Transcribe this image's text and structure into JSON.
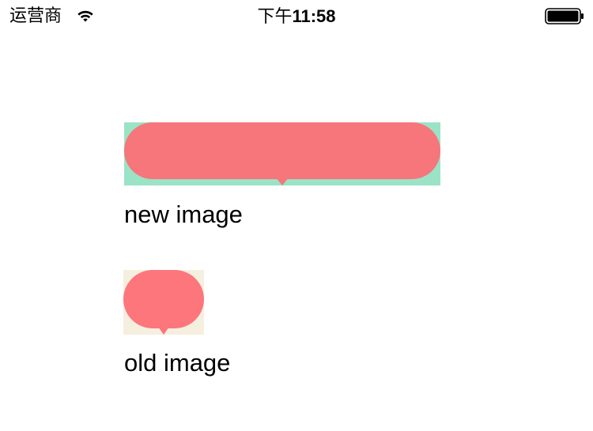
{
  "status_bar": {
    "carrier": "运营商",
    "time_prefix": "下午",
    "time": "11:58",
    "wifi_icon": "wifi-icon",
    "battery_icon": "battery-full-icon"
  },
  "samples": [
    {
      "caption": "new image",
      "bubble_color": "#F6767B",
      "background_color": "#9BE3C6",
      "icon": "speech-bubble-icon"
    },
    {
      "caption": "old image",
      "bubble_color": "#FD767C",
      "background_color": "#F5EFE0",
      "icon": "speech-bubble-icon"
    }
  ]
}
